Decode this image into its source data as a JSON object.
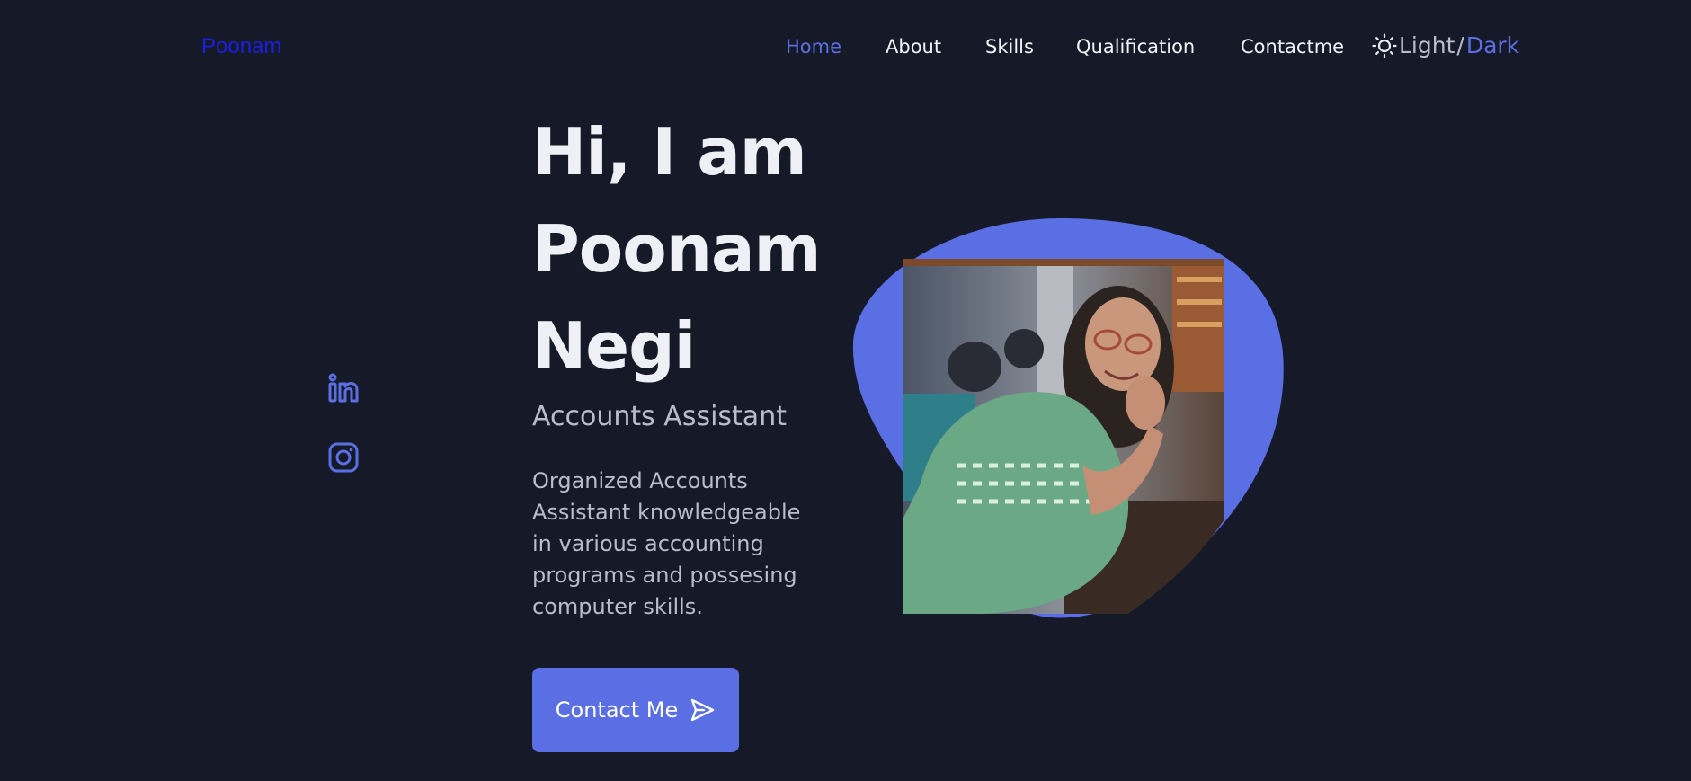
{
  "header": {
    "logo": "Poonam",
    "nav": [
      {
        "label": "Home",
        "active": true
      },
      {
        "label": "About",
        "active": false
      },
      {
        "label": "Skills",
        "active": false
      },
      {
        "label": "Qualification",
        "active": false
      },
      {
        "label": "Contactme",
        "active": false
      }
    ],
    "theme_toggle": {
      "icon": "sun-icon",
      "light_label": "Light",
      "separator": "/",
      "dark_label": "Dark"
    }
  },
  "social": [
    {
      "icon": "linkedin-icon"
    },
    {
      "icon": "instagram-icon"
    }
  ],
  "hero": {
    "title_lines": [
      "Hi, I am",
      "Poonam",
      "Negi"
    ],
    "subtitle": "Accounts Assistant",
    "description": "Organized Accounts Assistant knowledgeable in various accounting programs and possesing computer skills.",
    "cta_label": "Contact Me",
    "cta_icon": "send-icon"
  },
  "colors": {
    "background": "#161a28",
    "accent": "#5a6fe3",
    "logo": "#1a1fe0",
    "text_primary": "#eef0f5",
    "text_secondary": "#b9bdc9"
  }
}
